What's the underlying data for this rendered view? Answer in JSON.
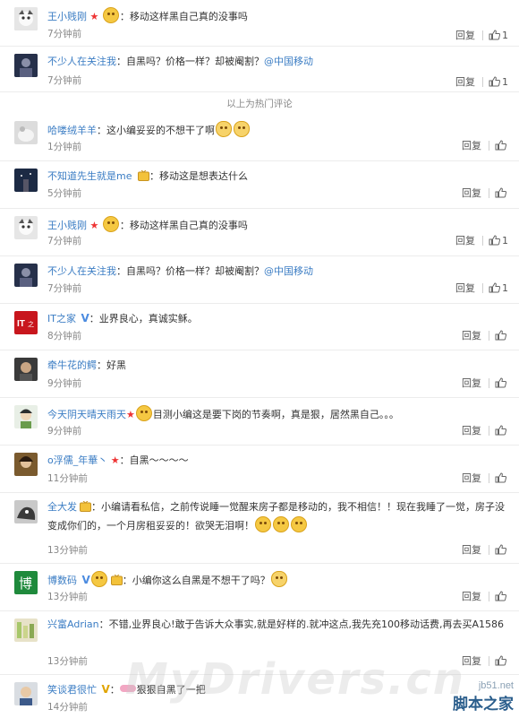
{
  "hot_divider": "以上为热门评论",
  "reply_label": "回复",
  "comments": [
    {
      "user": "王小贱刚",
      "sep": "：",
      "text": "移动这样黑自己真的没事吗",
      "time": "7分钟前",
      "likes": "1"
    },
    {
      "user": "不少人在关注我",
      "sep": "：",
      "text": "自黑吗？价格一样？却被阉割？",
      "mention": "@中国移动",
      "time": "7分钟前",
      "likes": "1"
    },
    {
      "user": "哈喽绒羊羊",
      "sep": "：",
      "text": "这小编妥妥的不想干了啊",
      "time": "1分钟前",
      "likes": ""
    },
    {
      "user": "不知道先生就是me",
      "sep": "：",
      "text": "移动这是想表达什么",
      "time": "5分钟前",
      "likes": ""
    },
    {
      "user": "王小贱刚",
      "sep": "：",
      "text": "移动这样黑自己真的没事吗",
      "time": "7分钟前",
      "likes": "1"
    },
    {
      "user": "不少人在关注我",
      "sep": "：",
      "text": "自黑吗？价格一样？却被阉割？",
      "mention": "@中国移动",
      "time": "7分钟前",
      "likes": "1"
    },
    {
      "user": "IT之家",
      "sep": "：",
      "text": "业界良心，真诚实稣。",
      "time": "8分钟前",
      "likes": ""
    },
    {
      "user": "牵牛花的鳄",
      "sep": "：",
      "text": "好黑",
      "time": "9分钟前",
      "likes": ""
    },
    {
      "user": "今天阴天晴天雨天",
      "sep": "",
      "text": "目测小编这是要下岗的节奏啊，真是狠，居然黑自己。。。",
      "time": "9分钟前",
      "likes": ""
    },
    {
      "user": "o浮儒_年華丶",
      "sep": "：",
      "text": "自黑～～～～",
      "time": "11分钟前",
      "likes": ""
    },
    {
      "user": "全大发",
      "sep": "：",
      "text": "小编请看私信，之前传说睡一觉醒来房子都是移动的，我不相信！！现在我睡了一觉，房子没变成你们的，一个月房租妥妥的！欲哭无泪啊！",
      "time": "13分钟前",
      "likes": ""
    },
    {
      "user": "博数码",
      "sep": "：",
      "text": "小编你这么自黑是不想干了吗？",
      "time": "13分钟前",
      "likes": ""
    },
    {
      "user": "兴富Adrian",
      "sep": "：",
      "text": "不错,业界良心!敢于告诉大众事实,就是好样的.就冲这点,我先充100移动话费,再去买A1586",
      "time": "13分钟前",
      "likes": ""
    },
    {
      "user": "笑谈君很忙",
      "sep": "：",
      "text": "狠狠自黑了一把",
      "time": "14分钟前",
      "likes": ""
    }
  ],
  "watermark_text": "MyDrivers.cn",
  "watermark_site_small": "jb51.net",
  "watermark_site_big": "脚本之家",
  "colors": {
    "link": "#3b7dc4",
    "muted": "#888888",
    "border": "#ececec"
  }
}
